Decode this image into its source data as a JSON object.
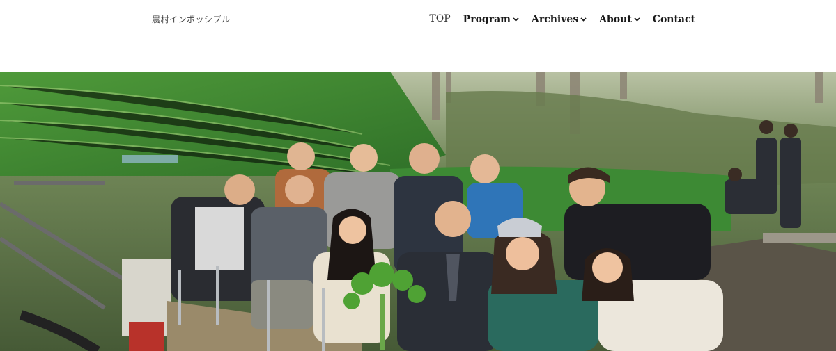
{
  "site": {
    "title": "農村インポッシブル"
  },
  "nav": {
    "items": [
      {
        "label": "TOP",
        "has_dropdown": false,
        "active": true
      },
      {
        "label": "Program",
        "has_dropdown": true,
        "active": false
      },
      {
        "label": "Archives",
        "has_dropdown": true,
        "active": false
      },
      {
        "label": "About",
        "has_dropdown": true,
        "active": false
      },
      {
        "label": "Contact",
        "has_dropdown": false,
        "active": false
      }
    ]
  },
  "hero": {
    "image": "group-photo-wasabi-field",
    "colors": {
      "foliage": "#3f8a2f",
      "forest": "#5e7048",
      "sky": "#d9d4c2"
    }
  }
}
